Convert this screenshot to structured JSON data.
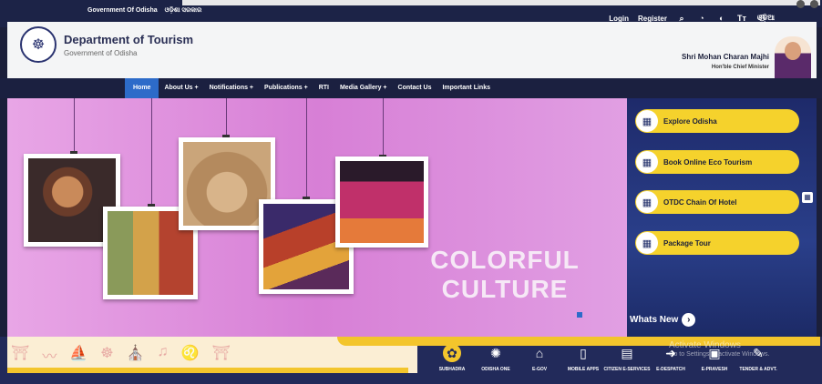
{
  "gov_strip": {
    "gov_label": "Government Of Odisha",
    "gov_label_odia": "ଓଡ଼ିଶା ସରକାର",
    "login": "Login",
    "register": "Register",
    "language": "ଓଡ଼ିଆ",
    "util_icons": [
      "search-icon",
      "sitemap-icon",
      "contrast-icon",
      "text-size-icon",
      "accessibility-icon"
    ]
  },
  "header": {
    "title": "Department of Tourism",
    "subtitle": "Government of Odisha",
    "cm_name": "Shri Mohan Charan Majhi",
    "cm_title": "Hon'ble Chief Minister"
  },
  "nav": {
    "items": [
      {
        "label": "Home",
        "active": true
      },
      {
        "label": "About Us +"
      },
      {
        "label": "Notifications +"
      },
      {
        "label": "Publications +"
      },
      {
        "label": "RTI"
      },
      {
        "label": "Media Gallery +"
      },
      {
        "label": "Contact Us"
      },
      {
        "label": "Important Links"
      }
    ]
  },
  "banner": {
    "line1": "COLORFUL",
    "line2": "CULTURE"
  },
  "side": {
    "links": [
      {
        "label": "Explore Odisha"
      },
      {
        "label": "Book Online Eco Tourism"
      },
      {
        "label": "OTDC Chain Of Hotel"
      },
      {
        "label": "Package Tour"
      }
    ],
    "whats_new": "Whats New"
  },
  "footer": {
    "services": [
      {
        "label": "SUBHADRA",
        "icon": "subhadra-icon"
      },
      {
        "label": "ODISHA ONE",
        "icon": "odisha-one-icon"
      },
      {
        "label": "E-GOV",
        "icon": "building-icon"
      },
      {
        "label": "MOBILE APPS",
        "icon": "mobile-icon"
      },
      {
        "label": "CITIZEN E-SERVICES",
        "icon": "citizen-icon"
      },
      {
        "label": "E-DESPATCH",
        "icon": "despatch-icon"
      },
      {
        "label": "E-PRAVESH",
        "icon": "pravesh-icon"
      },
      {
        "label": "TENDER & ADVT.",
        "icon": "tender-icon"
      }
    ],
    "watermark_line1": "Activate Windows",
    "watermark_line2": "Go to Settings to activate Windows."
  },
  "colors": {
    "accent_yellow": "#f5d22c",
    "nav_active": "#2d6bc9",
    "banner_pink": "#d77fd6",
    "navy": "#1b1f3a"
  }
}
